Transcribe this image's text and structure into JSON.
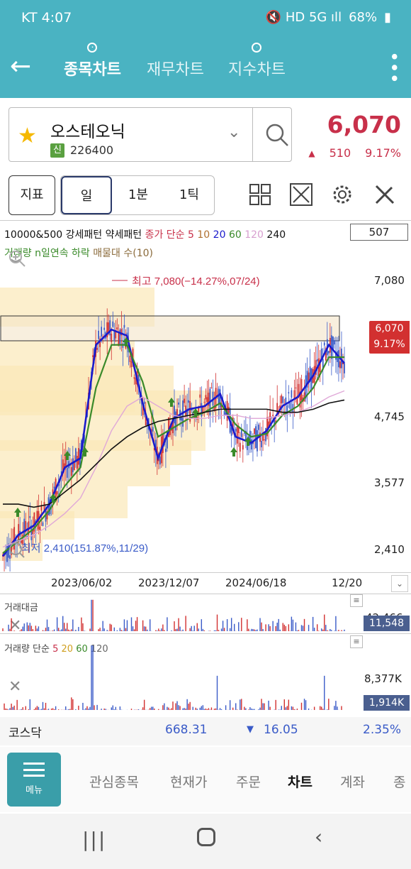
{
  "status": {
    "carrier": "KT",
    "time": "4:07",
    "icons": "🔇 HD 5G ıll",
    "battery": "68%"
  },
  "nav": {
    "tabs": [
      "종목차트",
      "재무차트",
      "지수차트"
    ],
    "active": 0
  },
  "stock": {
    "name": "오스테오닉",
    "market_badge": "신",
    "code": "226400",
    "price": "6,070",
    "change": "510",
    "change_pct": "9.17%",
    "change_dir": "up"
  },
  "toolbar": {
    "indicator_label": "지표",
    "periods": [
      "일",
      "1분",
      "1틱"
    ]
  },
  "legend": {
    "line1": "10000&500 강세패턴 약세패턴",
    "ma_label": "종가 단순",
    "ma_periods": [
      "5",
      "10",
      "20",
      "60",
      "120",
      "240"
    ],
    "line2_a": "거래량 n일연속 하락",
    "line2_b": "매물대 수(10)"
  },
  "count_box": "507",
  "main_chart": {
    "y_ticks": [
      "7,080",
      "4,745",
      "3,577",
      "2,410"
    ],
    "x_ticks": [
      "2023/06/02",
      "2023/12/07",
      "2024/06/18",
      "12/20"
    ],
    "high_label": "최고 7,080(−14.27%,07/24)",
    "low_label": "최저 2,410(151.87%,11/29)",
    "last_price": "6,070",
    "last_pct": "9.17%"
  },
  "volume_amount": {
    "title": "거래대금",
    "max": "42,466",
    "last": "11,548"
  },
  "volume": {
    "title": "거래량 단순",
    "ma_periods": [
      "5",
      "20",
      "60",
      "120"
    ],
    "max": "8,377K",
    "last": "1,914K"
  },
  "index": {
    "name": "코스닥",
    "value": "668.31",
    "change": "16.05",
    "pct": "2.35%"
  },
  "bottom_nav": {
    "menu_label": "메뉴",
    "items": [
      "관심종목",
      "현재가",
      "주문",
      "차트",
      "계좌",
      "종"
    ],
    "active": 3
  },
  "colors": {
    "header": "#4ab3c2",
    "up": "#c8304a",
    "down": "#3a5bc8",
    "ma5": "#1a1acc",
    "ma20": "#3a8a2a"
  },
  "chart_data": {
    "type": "candlestick",
    "ylim": [
      2410,
      7080
    ],
    "ma_lines": [
      {
        "name": "5",
        "values": [
          2450,
          2800,
          2950,
          3300,
          3900,
          4050,
          5900,
          6150,
          6050,
          4950,
          4050,
          4700,
          4850,
          4900,
          5100,
          4400,
          4300,
          4500,
          4900,
          5050,
          5400,
          5900,
          5600
        ]
      },
      {
        "name": "20",
        "values": [
          2500,
          2700,
          2900,
          3200,
          3600,
          3900,
          5200,
          5900,
          5900,
          5300,
          4400,
          4550,
          4700,
          4800,
          4950,
          4600,
          4400,
          4450,
          4750,
          4900,
          5200,
          5700,
          5700
        ]
      },
      {
        "name": "120",
        "values": [
          2600,
          2700,
          2800,
          2950,
          3150,
          3400,
          3900,
          4500,
          4900,
          5050,
          4900,
          4750,
          4700,
          4700,
          4750,
          4750,
          4700,
          4700,
          4750,
          4800,
          4900,
          5050,
          5150
        ]
      },
      {
        "name": "240",
        "values": [
          3300,
          3300,
          3250,
          3300,
          3500,
          3700,
          3950,
          4200,
          4400,
          4550,
          4650,
          4700,
          4750,
          4800,
          4850,
          4850,
          4850,
          4850,
          4800,
          4800,
          4850,
          4950,
          5000
        ]
      }
    ]
  }
}
